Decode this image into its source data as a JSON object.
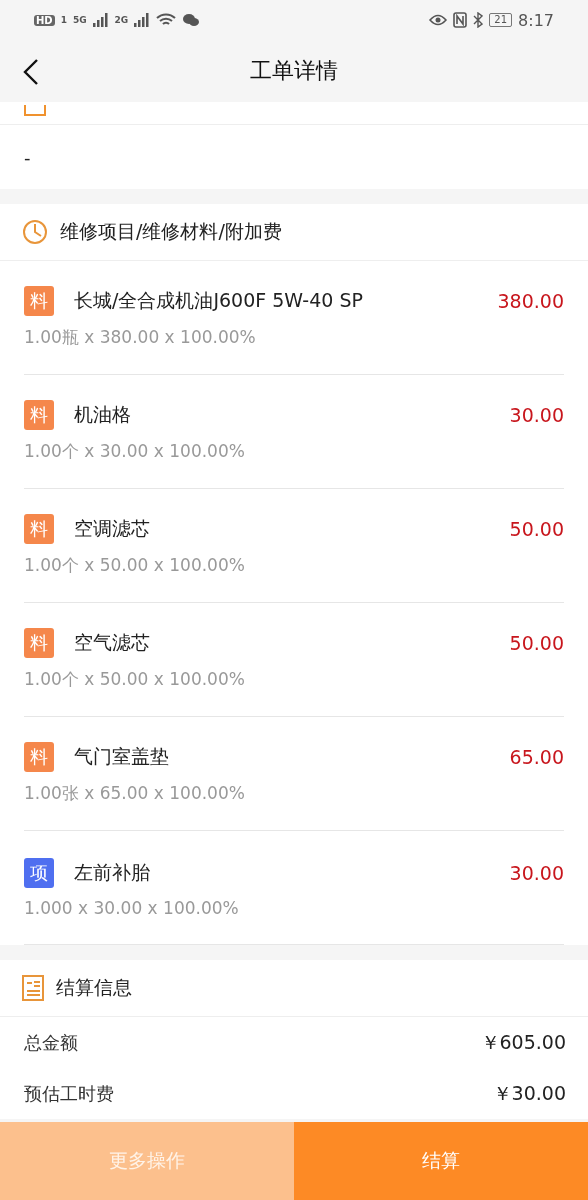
{
  "status_bar": {
    "hd": "HD",
    "sim": "1",
    "net1": "5G",
    "net2": "2G",
    "battery": "21",
    "time": "8:17"
  },
  "nav": {
    "title": "工单详情"
  },
  "remark": {
    "value": "-"
  },
  "items_section": {
    "title": "维修项目/维修材料/附加费",
    "items": [
      {
        "kind": "material",
        "badge": "料",
        "name": "长城/全合成机油J600F 5W-40 SP",
        "price": "380.00",
        "detail": "1.00瓶 x 380.00 x 100.00%"
      },
      {
        "kind": "material",
        "badge": "料",
        "name": "机油格",
        "price": "30.00",
        "detail": "1.00个 x 30.00 x 100.00%"
      },
      {
        "kind": "material",
        "badge": "料",
        "name": "空调滤芯",
        "price": "50.00",
        "detail": "1.00个 x 50.00 x 100.00%"
      },
      {
        "kind": "material",
        "badge": "料",
        "name": "空气滤芯",
        "price": "50.00",
        "detail": "1.00个 x 50.00 x 100.00%"
      },
      {
        "kind": "material",
        "badge": "料",
        "name": "气门室盖垫",
        "price": "65.00",
        "detail": "1.00张 x 65.00 x 100.00%"
      },
      {
        "kind": "project",
        "badge": "项",
        "name": "左前补胎",
        "price": "30.00",
        "detail": "1.000 x 30.00 x 100.00%"
      }
    ]
  },
  "settlement": {
    "title": "结算信息",
    "rows": [
      {
        "label": "总金额",
        "value": "￥605.00"
      },
      {
        "label": "预估工时费",
        "value": "￥30.00"
      }
    ]
  },
  "actions": [
    {
      "label": "更多操作",
      "kind": "secondary"
    },
    {
      "label": "结算",
      "kind": "primary"
    }
  ]
}
